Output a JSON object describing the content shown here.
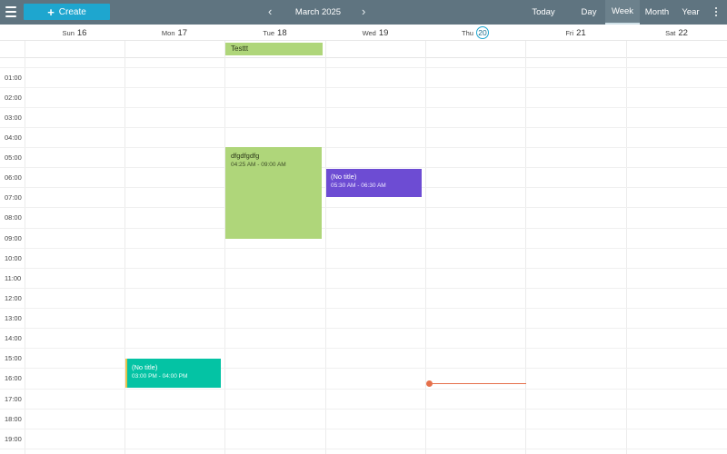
{
  "toolbar": {
    "create_label": "Create",
    "plus_glyph": "+",
    "prev_glyph": "‹",
    "next_glyph": "›",
    "period_title": "March 2025",
    "today_label": "Today",
    "views": {
      "day": "Day",
      "week": "Week",
      "month": "Month",
      "year": "Year"
    },
    "active_view": "Week",
    "menu_icon": "hamburger-menu-icon",
    "more_icon": "vertical-dots-icon"
  },
  "days": [
    {
      "name": "Sun",
      "num": "16"
    },
    {
      "name": "Mon",
      "num": "17"
    },
    {
      "name": "Tue",
      "num": "18"
    },
    {
      "name": "Wed",
      "num": "19"
    },
    {
      "name": "Thu",
      "num": "20",
      "today": true
    },
    {
      "name": "Fri",
      "num": "21"
    },
    {
      "name": "Sat",
      "num": "22"
    }
  ],
  "time_labels": [
    "01:00",
    "02:00",
    "03:00",
    "04:00",
    "05:00",
    "06:00",
    "07:00",
    "08:00",
    "09:00",
    "10:00",
    "11:00",
    "12:00",
    "13:00",
    "14:00",
    "15:00",
    "16:00",
    "17:00",
    "18:00",
    "19:00"
  ],
  "events": {
    "allday_tue": {
      "title": "Testtt",
      "color": "#afd67a"
    },
    "tue_main": {
      "title": "dfgdfgdfg",
      "time": "04:25 AM - 09:00 AM",
      "color": "#afd67a"
    },
    "wed_untitled": {
      "title": "(No title)",
      "time": "05:30 AM - 06:30 AM",
      "color": "#6d4cd3"
    },
    "mon_untitled": {
      "title": "(No title)",
      "time": "03:00 PM - 04:00 PM",
      "color": "#04c3a4"
    }
  },
  "colors": {
    "topbar": "#5f7480",
    "accent": "#1ea6cf",
    "now_indicator": "#e5704b"
  }
}
